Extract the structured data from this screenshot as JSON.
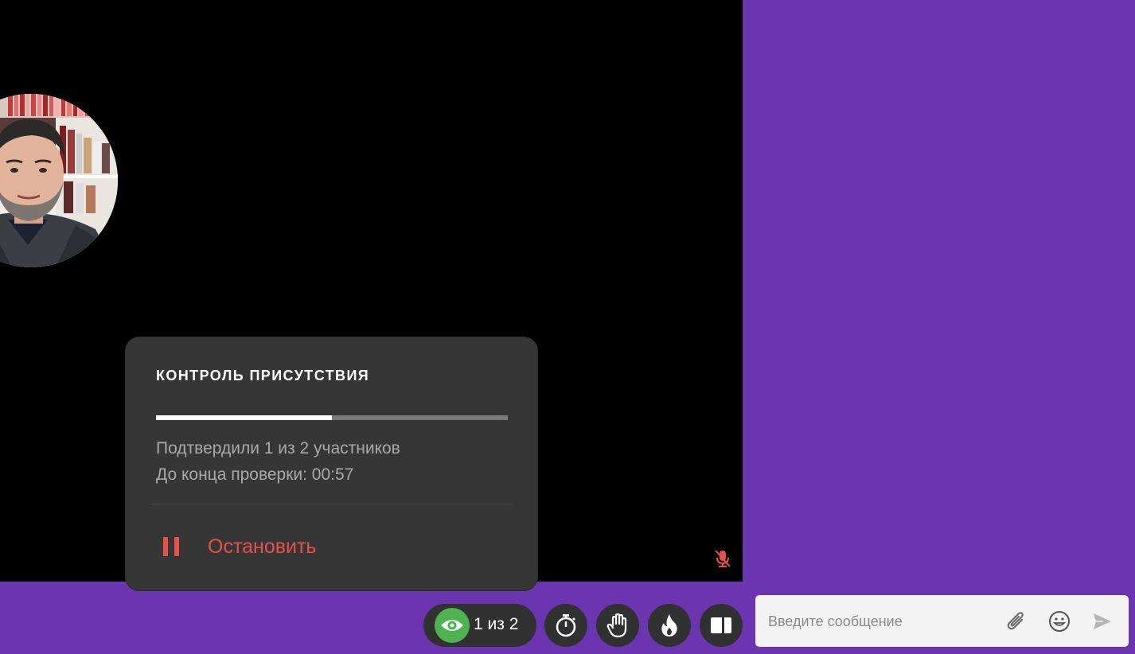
{
  "presence_popup": {
    "title": "КОНТРОЛЬ ПРИСУТСТВИЯ",
    "progress_fraction": 0.5,
    "confirmed_text": "Подтвердили 1 из 2 участников",
    "timer_text": "До конца проверки: 00:57",
    "stop_label": "Остановить"
  },
  "toolbar": {
    "presence_count": "1 из 2",
    "buttons": [
      {
        "name": "timer",
        "icon": "stopwatch-icon"
      },
      {
        "name": "raise-hand",
        "icon": "hand-icon"
      },
      {
        "name": "reactions",
        "icon": "fire-icon"
      },
      {
        "name": "layout",
        "icon": "layout-icon"
      }
    ]
  },
  "chat": {
    "placeholder": "Введите сообщение"
  },
  "colors": {
    "brand_purple": "#6c35b0",
    "accent_green": "#4db24f",
    "danger_red": "#e5524a",
    "panel_dark": "#363636"
  }
}
